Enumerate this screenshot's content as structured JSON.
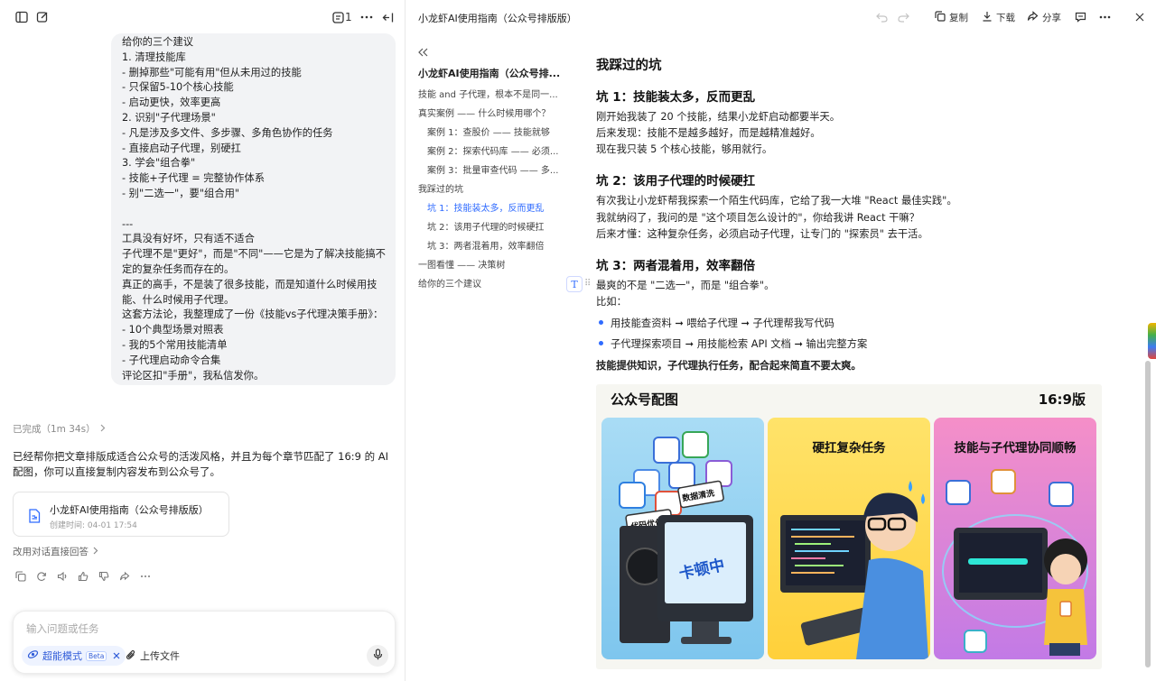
{
  "left": {
    "topbar": {
      "count": "1"
    },
    "message_lines": [
      "给你的三个建议",
      "1. 清理技能库",
      "- 删掉那些\"可能有用\"但从未用过的技能",
      "- 只保留5-10个核心技能",
      "- 启动更快，效率更高",
      "2. 识别\"子代理场景\"",
      "- 凡是涉及多文件、多步骤、多角色协作的任务",
      "- 直接启动子代理，别硬扛",
      "3. 学会\"组合拳\"",
      "- 技能+子代理 = 完整协作体系",
      "- 别\"二选一\"，要\"组合用\"",
      "",
      "---",
      "工具没有好坏，只有适不适合",
      "子代理不是\"更好\"，而是\"不同\"——它是为了解决技能搞不",
      "定的复杂任务而存在的。",
      "真正的高手，不是装了很多技能，而是知道什么时候用技",
      "能、什么时候用子代理。",
      "这套方法论，我整理成了一份《技能vs子代理决策手册》：",
      "- 10个典型场景对照表",
      "- 我的5个常用技能清单",
      "- 子代理启动命令合集",
      "评论区扣\"手册\"，我私信发你。"
    ],
    "done_label": "已完成（1m 34s）",
    "reply_text": "已经帮你把文章排版成适合公众号的活泼风格，并且为每个章节匹配了 16:9 的 AI 配图，你可以直接复制内容发布到公众号了。",
    "doc_card": {
      "title": "小龙虾AI使用指南（公众号排版版）",
      "created": "创建时间: 04-01 17:54"
    },
    "alt_label": "改用对话直接回答",
    "input": {
      "placeholder": "输入问题或任务",
      "mode_label": "超能模式",
      "beta_label": "Beta",
      "upload_label": "上传文件"
    }
  },
  "right": {
    "doc_name": "小龙虾AI使用指南（公众号排版版）",
    "toolbar": {
      "copy": "复制",
      "download": "下载",
      "share": "分享"
    },
    "toc": {
      "title": "小龙虾AI使用指南（公众号排...",
      "items": [
        "技能 and 子代理，根本不是同一...",
        "真实案例 —— 什么时候用哪个？",
        "案例 1：查股价 —— 技能就够",
        "案例 2：探索代码库 —— 必须...",
        "案例 3：批量审查代码 —— 多...",
        "我踩过的坑",
        "坑 1：技能装太多，反而更乱",
        "坑 2：该用子代理的时候硬扛",
        "坑 3：两者混着用，效率翻倍",
        "一图看懂 —— 决策树",
        "给你的三个建议"
      ]
    },
    "doc": {
      "h2": "我踩过的坑",
      "pit1_title": "坑 1：技能装太多，反而更乱",
      "pit1_lines": [
        "刚开始我装了 20 个技能，结果小龙虾启动都要半天。",
        "后来发现：技能不是越多越好，而是越精准越好。",
        "现在我只装 5 个核心技能，够用就行。"
      ],
      "pit2_title": "坑 2：该用子代理的时候硬扛",
      "pit2_lines": [
        "有次我让小龙虾帮我探索一个陌生代码库，它给了我一大堆 \"React 最佳实践\"。",
        "我就纳闷了，我问的是 \"这个项目怎么设计的\"，你给我讲 React 干嘛？",
        "后来才懂：这种复杂任务，必须启动子代理，让专门的 \"探索员\" 去干活。"
      ],
      "pit3_title": "坑 3：两者混着用，效率翻倍",
      "pit3_lines": [
        "最爽的不是 \"二选一\"，而是 \"组合拳\"。",
        "比如："
      ],
      "bullets": [
        "用技能查资料 ➞ 喂给子代理 ➞ 子代理帮我写代码",
        "子代理探索项目 ➞ 用技能检索 API 文档 ➞ 输出完整方案"
      ],
      "summary": "技能提供知识，子代理执行任务，配合起来简直不要太爽。"
    },
    "image": {
      "title_left": "公众号配图",
      "title_right": "16:9版",
      "panel_labels": [
        "硬扛复杂任务",
        "技能与子代理协同顺畅"
      ],
      "monitor_text": "卡顿中",
      "card_texts": [
        "代码优化",
        "数据清洗"
      ]
    }
  },
  "colors": {
    "accent": "#2f6bff",
    "bubble": "#f2f3f5"
  }
}
